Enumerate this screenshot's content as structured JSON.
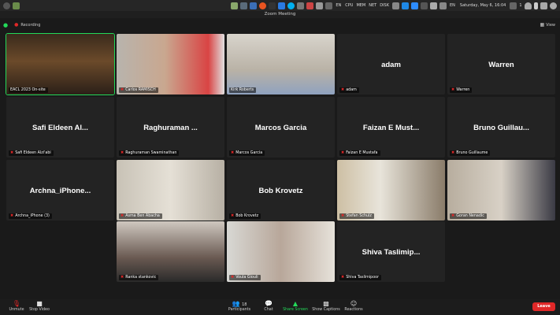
{
  "system_bar": {
    "keyboard": "EN",
    "cpu": "CPU",
    "mem": "MEM",
    "net": "NET",
    "disk": "DISK",
    "datetime": "Saturday, May  6, 16:04",
    "notifications": "1",
    "lang": "EN"
  },
  "window": {
    "title": "Zoom Meeting"
  },
  "infobar": {
    "recording_label": "Recording",
    "view_label": "View"
  },
  "participants": [
    {
      "label": "EACL 2023 On-site",
      "name": "",
      "video": true,
      "active": true,
      "muted": false
    },
    {
      "label": "Carlos RAMISCH",
      "name": "",
      "video": true,
      "muted": true
    },
    {
      "label": "Kirk Roberts",
      "name": "",
      "video": true,
      "muted": false
    },
    {
      "label": "adam",
      "name": "adam",
      "video": false,
      "muted": true
    },
    {
      "label": "Warren",
      "name": "Warren",
      "video": false,
      "muted": true
    },
    {
      "label": "Safi Eldeen Alzi'abi",
      "name": "Safi Eldeen Al...",
      "video": false,
      "muted": true
    },
    {
      "label": "Raghuraman Swaminathan",
      "name": "Raghuraman ...",
      "video": false,
      "muted": true
    },
    {
      "label": "Marcos Garcia",
      "name": "Marcos Garcia",
      "video": false,
      "muted": true
    },
    {
      "label": "Faizan E Mustafa",
      "name": "Faizan E Must...",
      "video": false,
      "muted": true
    },
    {
      "label": "Bruno Guillaume",
      "name": "Bruno Guillau...",
      "video": false,
      "muted": true
    },
    {
      "label": "Archna_iPhone (3)",
      "name": "Archna_iPhone...",
      "video": false,
      "muted": true
    },
    {
      "label": "Asma Ben Abacha",
      "name": "",
      "video": true,
      "muted": true
    },
    {
      "label": "Bob Krovetz",
      "name": "Bob Krovetz",
      "video": false,
      "muted": true
    },
    {
      "label": "Stefan Schulz",
      "name": "",
      "video": true,
      "muted": true
    },
    {
      "label": "Goran Nenadic",
      "name": "",
      "video": true,
      "muted": true
    },
    {
      "label": "Ranka stankovic",
      "name": "",
      "video": true,
      "muted": true
    },
    {
      "label": "Voula Giouli",
      "name": "",
      "video": true,
      "muted": true
    },
    {
      "label": "Shiva Taslimipoor",
      "name": "Shiva Taslimip...",
      "video": false,
      "muted": true
    }
  ],
  "toolbar": {
    "unmute": "Unmute",
    "stop_video": "Stop Video",
    "participants": "Participants",
    "participants_count": "18",
    "chat": "Chat",
    "share_screen": "Share Screen",
    "show_captions": "Show Captions",
    "reactions": "Reactions",
    "leave": "Leave"
  },
  "colors": {
    "accent_green": "#23d959",
    "leave_red": "#e02828",
    "muted_red": "#e02828"
  }
}
